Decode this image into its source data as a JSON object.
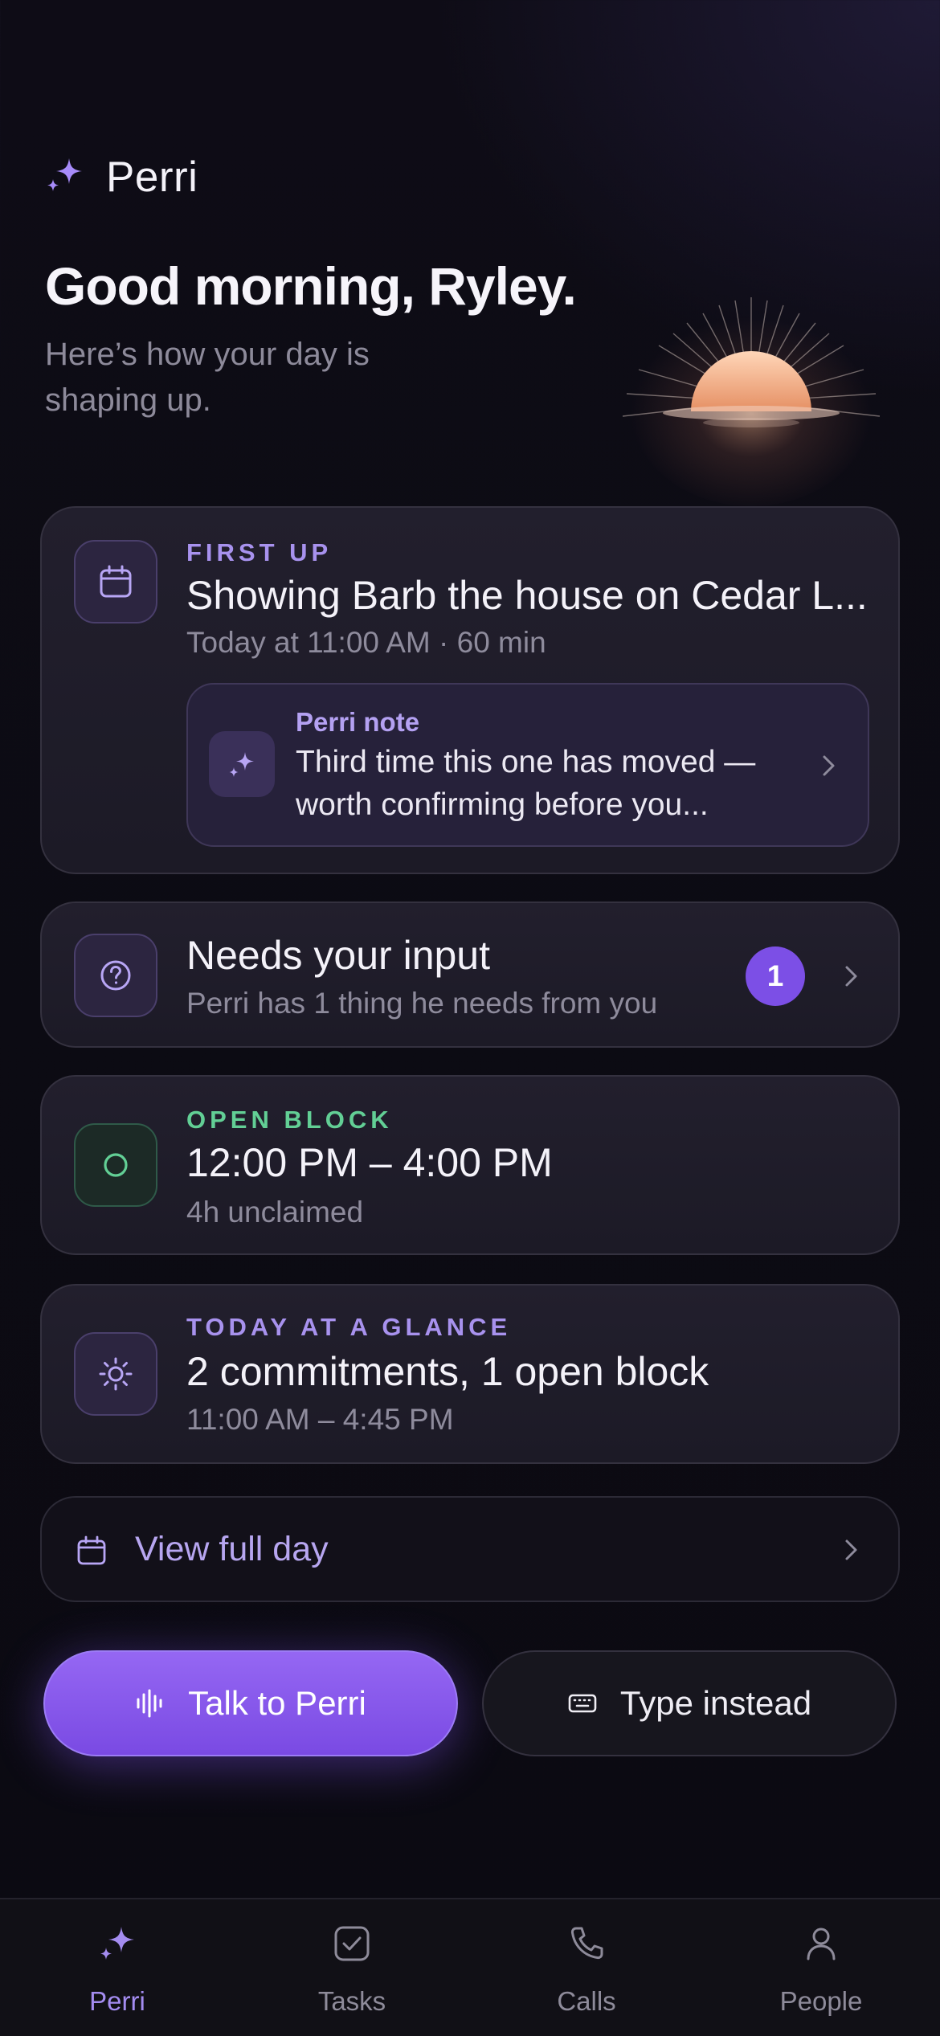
{
  "app": {
    "name": "Perri"
  },
  "header": {
    "greeting": "Good morning, Ryley.",
    "subtitle": "Here’s how your day is shaping up."
  },
  "first_up": {
    "eyebrow": "FIRST UP",
    "title": "Showing Barb the house on Cedar L...",
    "meta": "Today at 11:00 AM · 60 min",
    "icon": "calendar-icon",
    "note": {
      "label": "Perri note",
      "text": "Third time this one has moved — worth confirming before you...",
      "icon": "sparkle-icon"
    }
  },
  "needs_input": {
    "title": "Needs your input",
    "meta": "Perri has 1 thing he needs from you",
    "badge": "1",
    "icon": "question-circle-icon"
  },
  "open_block": {
    "eyebrow": "OPEN BLOCK",
    "title": "12:00 PM – 4:00 PM",
    "meta": "4h unclaimed",
    "icon": "circle-icon"
  },
  "glance": {
    "eyebrow": "TODAY AT A GLANCE",
    "title": "2 commitments, 1 open block",
    "meta": "11:00 AM – 4:45 PM",
    "icon": "sun-icon"
  },
  "view_full_day": {
    "label": "View full day",
    "icon": "calendar-icon"
  },
  "actions": {
    "talk": {
      "label": "Talk to Perri",
      "icon": "waveform-icon"
    },
    "type": {
      "label": "Type instead",
      "icon": "keyboard-icon"
    }
  },
  "tabs": [
    {
      "label": "Perri",
      "icon": "sparkle-icon",
      "active": true
    },
    {
      "label": "Tasks",
      "icon": "checkbox-icon",
      "active": false
    },
    {
      "label": "Calls",
      "icon": "phone-icon",
      "active": false
    },
    {
      "label": "People",
      "icon": "person-icon",
      "active": false
    }
  ],
  "colors": {
    "accent": "#7c4fe6",
    "accent_text": "#a892ee",
    "open_block_green": "#62cf95",
    "background": "#0d0c14"
  }
}
